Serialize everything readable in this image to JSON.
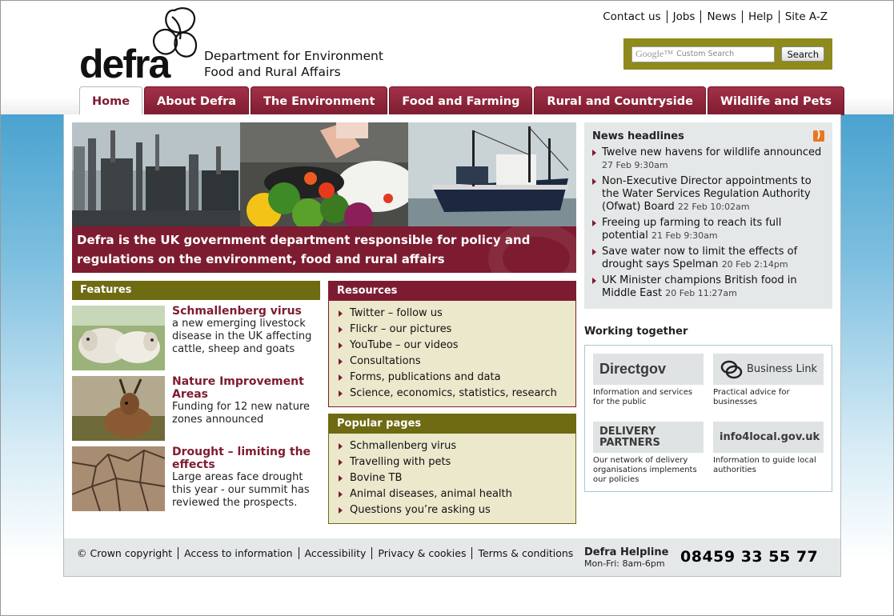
{
  "header": {
    "logo_word": "defra",
    "dept_line1": "Department for Environment",
    "dept_line2": "Food and Rural Affairs",
    "utility_links": [
      "Contact us",
      "Jobs",
      "News",
      "Help",
      "Site A-Z"
    ],
    "search": {
      "google_label": "Google™",
      "placeholder": "Custom Search",
      "button": "Search"
    }
  },
  "tabs": [
    "Home",
    "About Defra",
    "The Environment",
    "Food and Farming",
    "Rural and Countryside",
    "Wildlife and Pets"
  ],
  "active_tab": "Home",
  "hero": {
    "caption": "Defra is the UK government department responsible for policy and regulations on the environment, food and rural affairs"
  },
  "features": {
    "heading": "Features",
    "items": [
      {
        "title": "Schmallenberg virus",
        "text": "a new emerging livestock disease in the UK affecting cattle, sheep and goats"
      },
      {
        "title": "Nature Improvement Areas",
        "text": "Funding for 12 new nature zones announced"
      },
      {
        "title": "Drought – limiting the effects",
        "text": "Large areas face drought this year - our summit has reviewed the prospects."
      }
    ]
  },
  "resources": {
    "heading": "Resources",
    "items": [
      "Twitter – follow us",
      "Flickr – our pictures",
      "YouTube – our videos",
      "Consultations",
      "Forms, publications and data",
      "Science, economics, statistics, research"
    ]
  },
  "popular": {
    "heading": "Popular pages",
    "items": [
      "Schmallenberg virus",
      "Travelling with pets",
      "Bovine TB",
      "Animal diseases, animal health",
      "Questions you’re asking us"
    ]
  },
  "news": {
    "heading": "News headlines",
    "items": [
      {
        "title": "Twelve new havens for wildlife announced",
        "date": "27 Feb 9:30am"
      },
      {
        "title": "Non-Executive Director appointments to the Water Services Regulation Authority (Ofwat) Board",
        "date": "22 Feb 10:02am"
      },
      {
        "title": "Freeing up farming to reach its full potential",
        "date": "21 Feb 9:30am"
      },
      {
        "title": "Save water now to limit the effects of drought says Spelman",
        "date": "20 Feb 2:14pm"
      },
      {
        "title": "UK Minister champions British food in Middle East",
        "date": "20 Feb 11:27am"
      }
    ]
  },
  "working_together": {
    "heading": "Working together",
    "partners": [
      {
        "logo": "Directgov",
        "desc": "Information and services for the public"
      },
      {
        "logo": "Business Link",
        "desc": "Practical advice for businesses"
      },
      {
        "logo": "DELIVERY PARTNERS",
        "desc": "Our network of delivery organisations implements our policies"
      },
      {
        "logo": "info4local.gov.uk",
        "desc": "Information to guide local authorities"
      }
    ]
  },
  "footer": {
    "links": [
      "© Crown copyright",
      "Access to information",
      "Accessibility",
      "Privacy & cookies",
      "Terms & conditions"
    ],
    "helpline_title": "Defra Helpline",
    "helpline_hours": "Mon-Fri: 8am-6pm",
    "phone": "08459 33 55 77"
  },
  "colors": {
    "maroon": "#7d1c30",
    "olive": "#6e6b12",
    "search_band": "#8e8a1c",
    "sky": "#4aa3cf"
  }
}
